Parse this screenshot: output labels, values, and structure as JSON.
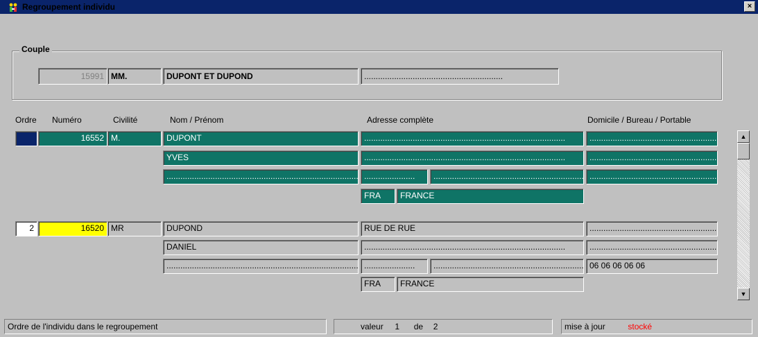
{
  "window": {
    "title": "Regroupement individu",
    "icon": "app-icon",
    "close_label": "×"
  },
  "couple": {
    "legend": "Couple",
    "numero": "15991",
    "civilite": "MM.",
    "nom": "DUPONT ET DUPOND",
    "extra": "............................................................"
  },
  "columns": {
    "ordre": "Ordre",
    "numero": "Numéro",
    "civilite": "Civilité",
    "nom": "Nom / Prénom",
    "adresse": "Adresse complète",
    "telephone": "Domicile / Bureau / Portable"
  },
  "records": [
    {
      "ordre": "",
      "numero": "16552",
      "civilite": "M.",
      "nom": "DUPONT",
      "prenom": "YVES",
      "nom_extra": ".......................................................................................",
      "adresse1": ".......................................................................................",
      "adresse2": ".......................................................................................",
      "cp": "......................",
      "ville": ".........................................................................",
      "pays_code": "FRA",
      "pays": "FRANCE",
      "tel1": ".........................................................",
      "tel2": ".........................................................",
      "tel3": "........................................................."
    },
    {
      "ordre": "2",
      "numero": "16520",
      "civilite": "MR",
      "nom": "DUPOND",
      "prenom": "DANIEL",
      "nom_extra": ".......................................................................................",
      "adresse1": "RUE DE RUE",
      "adresse2": ".......................................................................................",
      "cp": "......................",
      "ville": ".........................................................................",
      "pays_code": "FRA",
      "pays": "FRANCE",
      "tel1": ".........................................................",
      "tel2": ".........................................................",
      "tel3": "06 06 06 06 06"
    }
  ],
  "scrollbar": {
    "up_label": "▲",
    "down_label": "▼"
  },
  "status": {
    "hint": "Ordre de l'individu dans le regroupement",
    "valeur_label": "valeur",
    "valeur": "1",
    "de_label": "de",
    "total": "2",
    "update_label": "mise à jour",
    "update_state": "stocké"
  },
  "colors": {
    "titlebar": "#0a246a",
    "teal_row": "#0f7466",
    "highlight": "#ffff00",
    "stored": "#ff0000"
  }
}
